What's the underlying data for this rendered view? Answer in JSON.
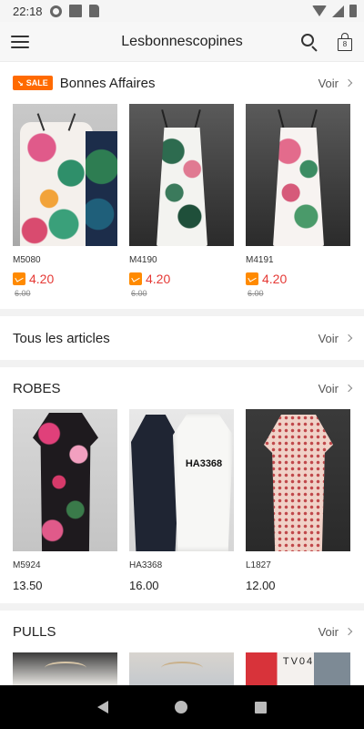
{
  "status_bar": {
    "time": "22:18"
  },
  "header": {
    "title": "Lesbonnescopines",
    "bag_count": "8"
  },
  "colors": {
    "accent": "#ff6a00",
    "sale_price": "#e53935"
  },
  "sections": {
    "deals": {
      "badge": "SALE",
      "title": "Bonnes Affaires",
      "link": "Voir",
      "products": [
        {
          "ref": "M5080",
          "price": "4.20",
          "old_price": "6.00"
        },
        {
          "ref": "M4190",
          "price": "4.20",
          "old_price": "6.00"
        },
        {
          "ref": "M4191",
          "price": "4.20",
          "old_price": "6.00"
        }
      ]
    },
    "all": {
      "title": "Tous les articles",
      "link": "Voir"
    },
    "robes": {
      "title": "ROBES",
      "link": "Voir",
      "products": [
        {
          "ref": "M5924",
          "price": "13.50"
        },
        {
          "ref": "HA3368",
          "price": "16.00",
          "tag": "HA3368"
        },
        {
          "ref": "L1827",
          "price": "12.00"
        }
      ]
    },
    "pulls": {
      "title": "PULLS",
      "link": "Voir",
      "tag": "TV04"
    }
  }
}
